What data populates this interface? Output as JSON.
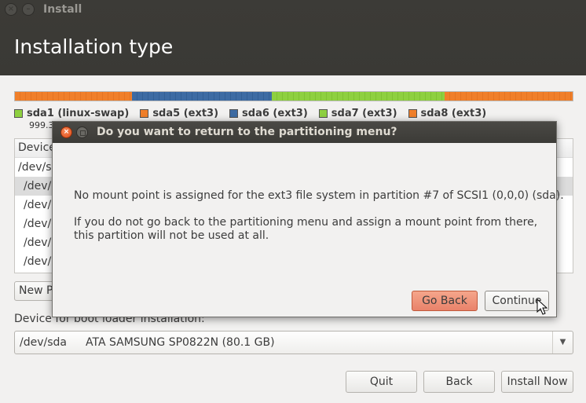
{
  "window": {
    "title": "Install",
    "close_glyph": "×",
    "min_glyph": "–",
    "page_title": "Installation type"
  },
  "partition_bar": {
    "segments": [
      {
        "name": "sda1",
        "color": "#f07f2a",
        "share": 0.21
      },
      {
        "name": "sda6",
        "color": "#3d6ba3",
        "share": 0.25
      },
      {
        "name": "sda7",
        "color": "#8ed040",
        "share": 0.31
      },
      {
        "name": "sda8",
        "color": "#f07f2a",
        "share": 0.23
      }
    ]
  },
  "legend": [
    {
      "label": "sda1 (linux-swap)",
      "color": "#8ed040"
    },
    {
      "label": "sda5 (ext3)",
      "color": "#f07f2a"
    },
    {
      "label": "sda6 (ext3)",
      "color": "#3d6ba3"
    },
    {
      "label": "sda7 (ext3)",
      "color": "#8ed040"
    },
    {
      "label": "sda8 (ext3)",
      "color": "#f07f2a"
    }
  ],
  "legend_size": "999.3",
  "device_table": {
    "header": "Device",
    "rows": [
      "/dev/sd",
      "/dev/",
      "/dev/",
      "/dev/",
      "/dev/",
      "/dev/"
    ]
  },
  "new_partition_button": "New P",
  "boot_loader": {
    "label": "Device for boot loader installation:",
    "device": "/dev/sda",
    "description": "ATA SAMSUNG SP0822N (80.1 GB)"
  },
  "footer": {
    "quit": "Quit",
    "back": "Back",
    "install": "Install Now"
  },
  "dialog": {
    "title": "Do you want to return to the partitioning menu?",
    "message1": "No mount point is assigned for the ext3 file system in partition #7 of SCSI1 (0,0,0) (sda).",
    "message2": "If you do not go back to the partitioning menu and assign a mount point from there, this partition will not be used at all.",
    "go_back": "Go Back",
    "continue": "Continue",
    "close_glyph": "×"
  }
}
